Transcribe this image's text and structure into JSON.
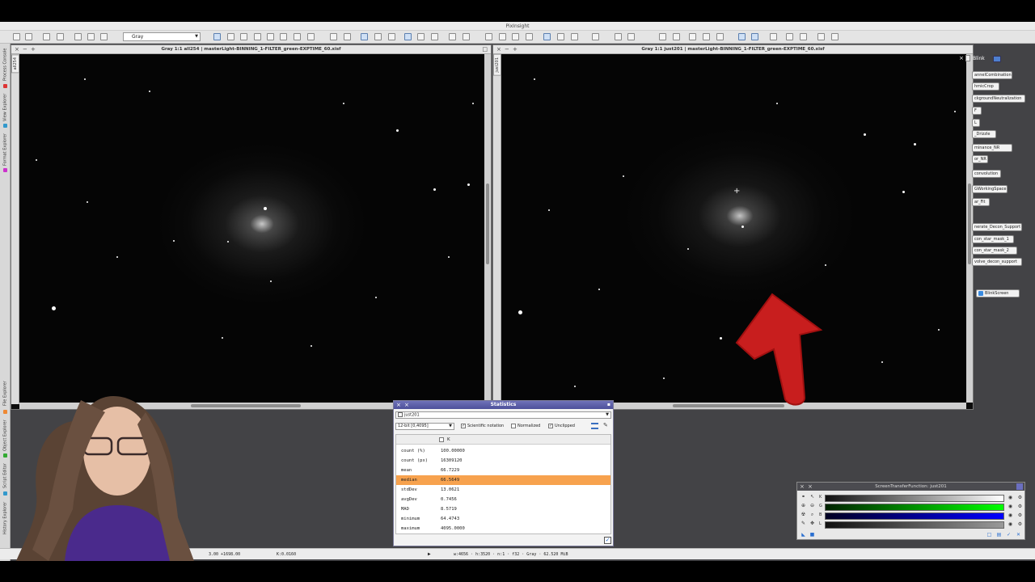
{
  "app": {
    "title": "PixInsight"
  },
  "toolbar": {
    "mode_select": "Gray"
  },
  "left_dock": {
    "tabs": [
      "Process Console",
      "View Explorer",
      "Format Explorer",
      "File Explorer",
      "Object Explorer",
      "Script Editor",
      "History Explorer"
    ]
  },
  "window_left": {
    "title": "Gray 1:1 all254 | masterLight-BINNING_1-FILTER_green-EXPTIME_60.xisf",
    "id": "all254"
  },
  "window_right": {
    "title": "Gray 1:1 just201 | masterLight-BINNING_1-FILTER_green-EXPTIME_60.xisf",
    "id": "just201"
  },
  "process_panel": {
    "blink_label": "Blink",
    "items": [
      "annelCombination",
      "hmicCrop",
      "ckgroundNeutralization",
      "F",
      "L",
      "_Drizzle",
      "minance_NR",
      "or_NR",
      "convolution",
      "GWorkingSpace",
      "ar_Fit",
      "nerate_Decon_Support",
      "con_star_mask_1",
      "con_star_mask_2",
      "volve_decon_support",
      "BlinkScreen"
    ]
  },
  "statistics": {
    "title": "Statistics",
    "view_select": "just201",
    "range_select": "12-bit [0,4095]",
    "scientific_label": "Scientific notation",
    "normalized_label": "Normalized",
    "unclipped_label": "Unclipped",
    "column_header": "K",
    "rows": [
      {
        "key": "count (%)",
        "value": "100.00000"
      },
      {
        "key": "count (px)",
        "value": "16309120"
      },
      {
        "key": "mean",
        "value": "66.7229"
      },
      {
        "key": "median",
        "value": "66.5649"
      },
      {
        "key": "stdDev",
        "value": "13.0621"
      },
      {
        "key": "avgDev",
        "value": "0.7456"
      },
      {
        "key": "MAD",
        "value": "8.5719"
      },
      {
        "key": "minimum",
        "value": "64.4743"
      },
      {
        "key": "maximum",
        "value": "4095.0000"
      }
    ]
  },
  "stf": {
    "title": "ScreenTransferFunction: just201",
    "channels": [
      "K",
      "G",
      "B",
      "L"
    ]
  },
  "statusbar": {
    "coords": "3.00  +1698.00",
    "kval": "K:0.0160",
    "info": "w:4656 · h:3520 · n:1 · f32 · Gray · 62.520 MiB"
  },
  "colors": {
    "accent": "#f7a24e",
    "stats_title": "#5a5da8",
    "arrow": "#c81e1e",
    "desktop": "#434346"
  }
}
